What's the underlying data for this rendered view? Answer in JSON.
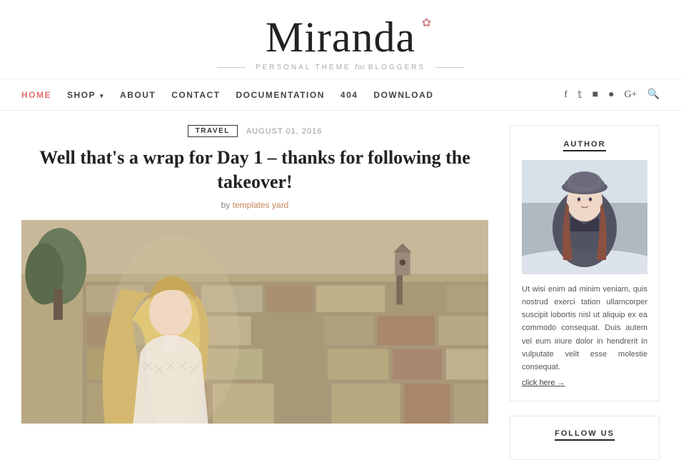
{
  "site": {
    "title": "Miranda",
    "flower": "❀",
    "tagline_before": "PERSONAL THEME",
    "tagline_italic": "for",
    "tagline_after": "BLOGGERS"
  },
  "nav": {
    "links": [
      {
        "label": "HOME",
        "active": true,
        "has_caret": false
      },
      {
        "label": "SHOP",
        "active": false,
        "has_caret": true
      },
      {
        "label": "ABOUT",
        "active": false,
        "has_caret": false
      },
      {
        "label": "CONTACT",
        "active": false,
        "has_caret": false
      },
      {
        "label": "DOCUMENTATION",
        "active": false,
        "has_caret": false
      },
      {
        "label": "404",
        "active": false,
        "has_caret": false
      },
      {
        "label": "DOWNLOAD",
        "active": false,
        "has_caret": false
      }
    ],
    "social_icons": [
      "f",
      "t",
      "i",
      "p",
      "g+",
      "🔍"
    ]
  },
  "article": {
    "category": "TRAVEL",
    "date": "AUGUST 01, 2016",
    "title": "Well that's a wrap for Day 1 – thanks for following the takeover!",
    "author_label": "by",
    "author_name": "templates yard"
  },
  "sidebar": {
    "author_widget": {
      "title": "AUTHOR",
      "bio": "Ut wisi enim ad minim veniam, quis nostrud exerci tation ullamcorper suscipit lobortis nisl ut aliquip ex ea commodo consequat. Duis autem vel eum iriure dolor in hendrerit in vulputate velit esse molestie consequat.",
      "link_text": "click here →"
    },
    "follow_widget": {
      "title": "FOLLOW US"
    }
  }
}
